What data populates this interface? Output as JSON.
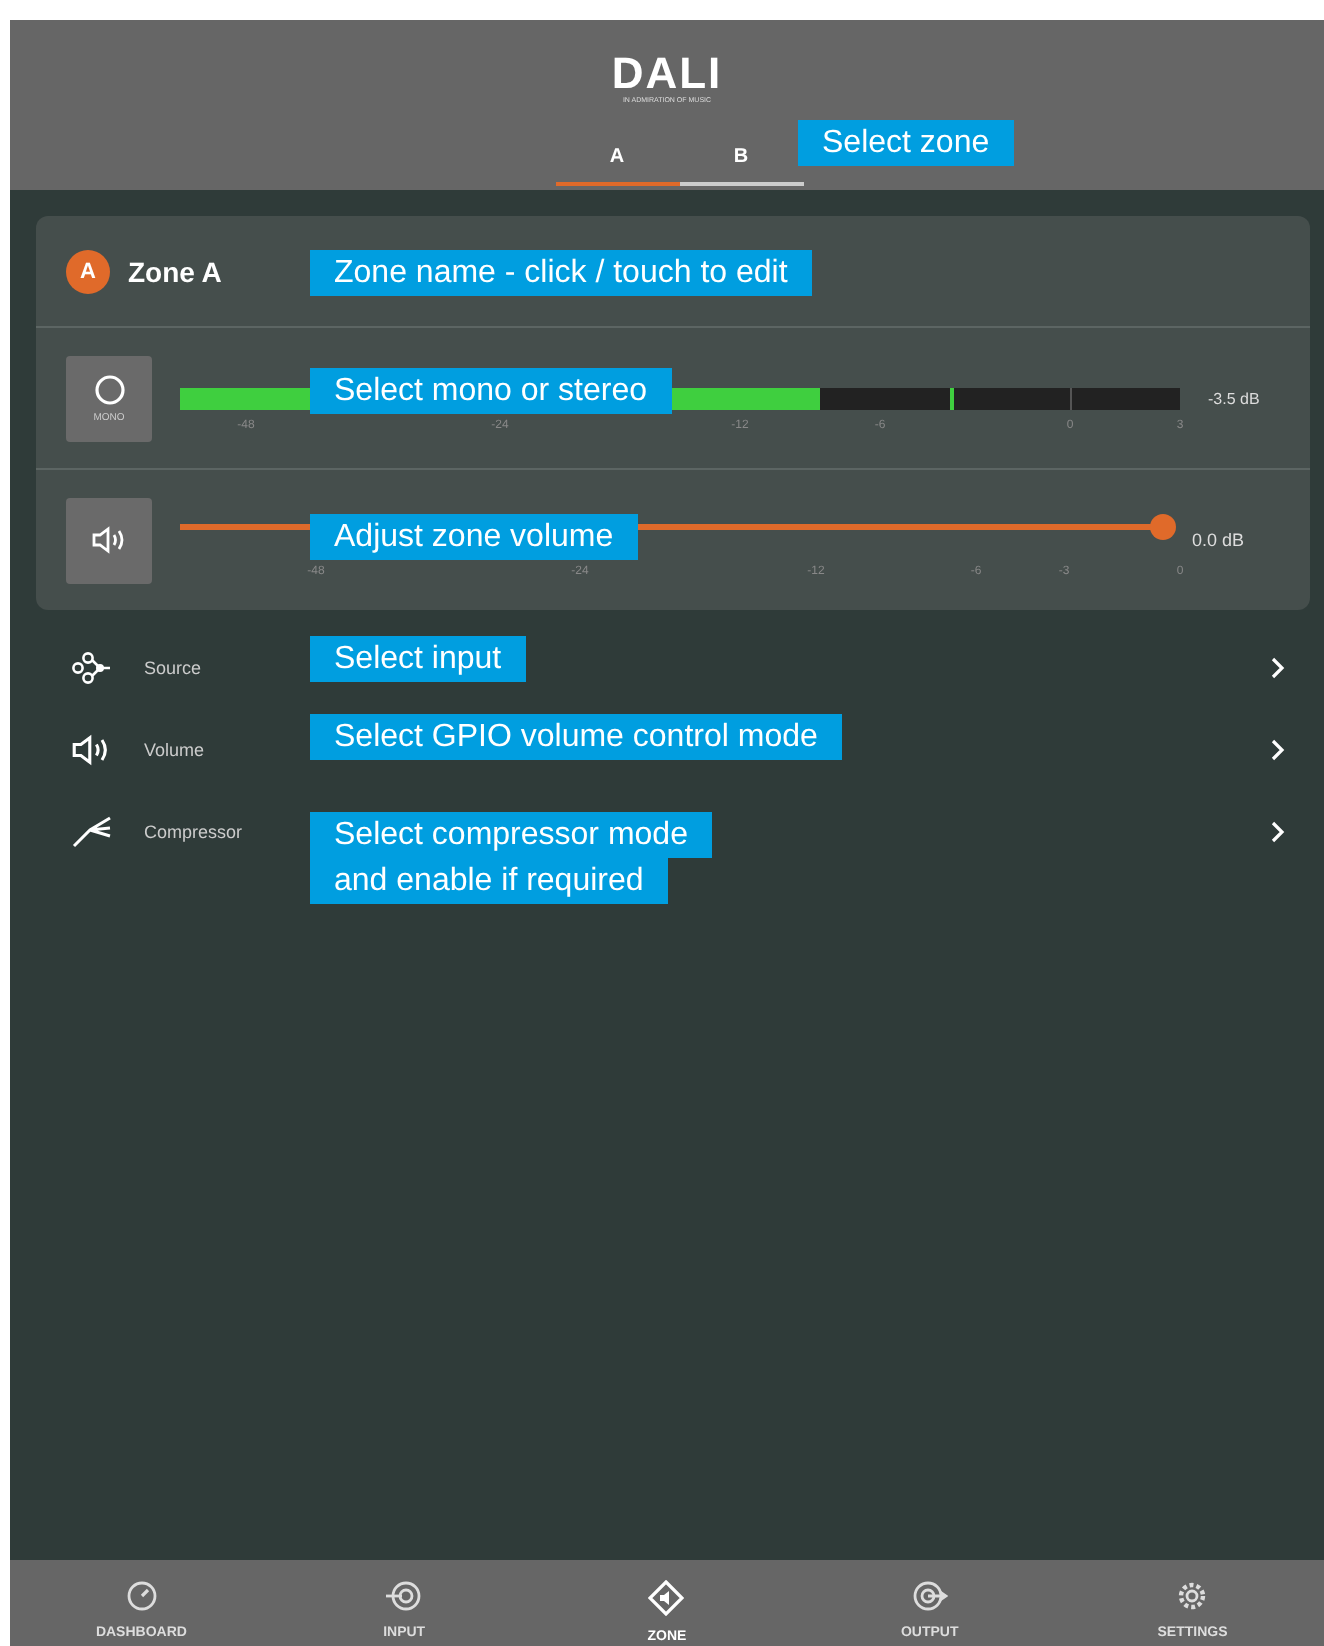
{
  "header": {
    "logo": "DALI",
    "tagline": "IN ADMIRATION OF MUSIC"
  },
  "tabs": [
    {
      "label": "A",
      "selected": true
    },
    {
      "label": "B",
      "selected": false
    }
  ],
  "zone": {
    "badge": "A",
    "name": "Zone A"
  },
  "meter": {
    "button_label": "MONO",
    "level": 0.64,
    "reading": "-3.5 dB",
    "ticks": [
      "-48",
      "-24",
      "-12",
      "-6",
      "0",
      "3"
    ]
  },
  "volume": {
    "level": 1.0,
    "reading": "0.0 dB",
    "ticks": [
      "-48",
      "-24",
      "-12",
      "-6",
      "-3",
      "0"
    ]
  },
  "menu": [
    {
      "kind": "source",
      "label": "Source"
    },
    {
      "kind": "volume",
      "label": "Volume"
    },
    {
      "kind": "compressor",
      "label": "Compressor"
    }
  ],
  "callouts": [
    {
      "lines": [
        "Select zone"
      ]
    },
    {
      "lines": [
        "Zone name - click / touch to edit"
      ]
    },
    {
      "lines": [
        "Select mono or stereo"
      ]
    },
    {
      "lines": [
        "Adjust zone volume"
      ]
    },
    {
      "lines": [
        "Select input"
      ]
    },
    {
      "lines": [
        "Select GPIO volume control mode"
      ]
    },
    {
      "lines": [
        "Select compressor mode",
        "and enable if required"
      ]
    }
  ],
  "nav": [
    {
      "kind": "dashboard",
      "label": "DASHBOARD",
      "selected": false
    },
    {
      "kind": "input",
      "label": "INPUT",
      "selected": false
    },
    {
      "kind": "zone",
      "label": "ZONE",
      "selected": true
    },
    {
      "kind": "output",
      "label": "OUTPUT",
      "selected": false
    },
    {
      "kind": "settings",
      "label": "SETTINGS",
      "selected": false
    }
  ]
}
